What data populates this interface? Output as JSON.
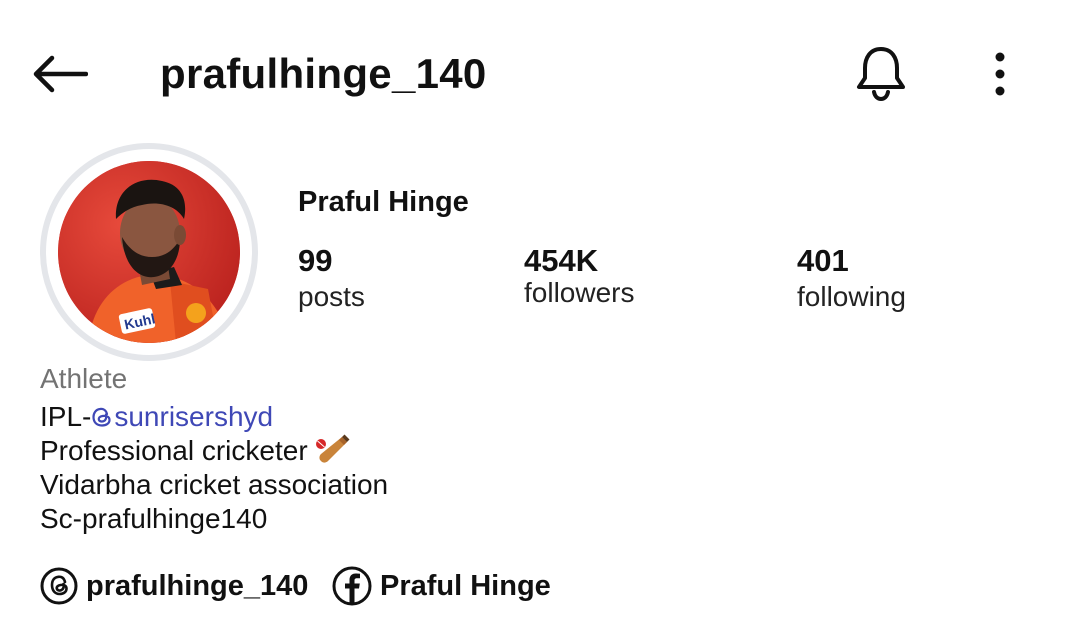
{
  "header": {
    "username": "prafulhinge_140",
    "back_icon": "arrow-left-icon",
    "bell_icon": "bell-icon",
    "more_icon": "more-vertical-icon"
  },
  "profile": {
    "name": "Praful Hinge",
    "avatar_icon": "profile-photo",
    "stats": {
      "posts": {
        "value": "99",
        "label": "posts"
      },
      "followers": {
        "value": "454K",
        "label": "followers"
      },
      "following": {
        "value": "401",
        "label": "following"
      }
    }
  },
  "bio": {
    "category": "Athlete",
    "line1_prefix": "IPL-",
    "line1_mention": "sunrisershyd",
    "line2": "Professional cricketer",
    "line2_emoji": "cricket-bat-icon",
    "line3": "Vidarbha cricket association",
    "line4": "Sc-prafulhinge140"
  },
  "links": {
    "threads": {
      "icon": "threads-icon",
      "label": "prafulhinge_140"
    },
    "facebook": {
      "icon": "facebook-icon",
      "label": "Praful Hinge"
    }
  },
  "colors": {
    "mention": "#3f48b6",
    "category": "#737373",
    "avatar_ring": "#e4e6ea",
    "avatar_bg": "#d8332a"
  }
}
